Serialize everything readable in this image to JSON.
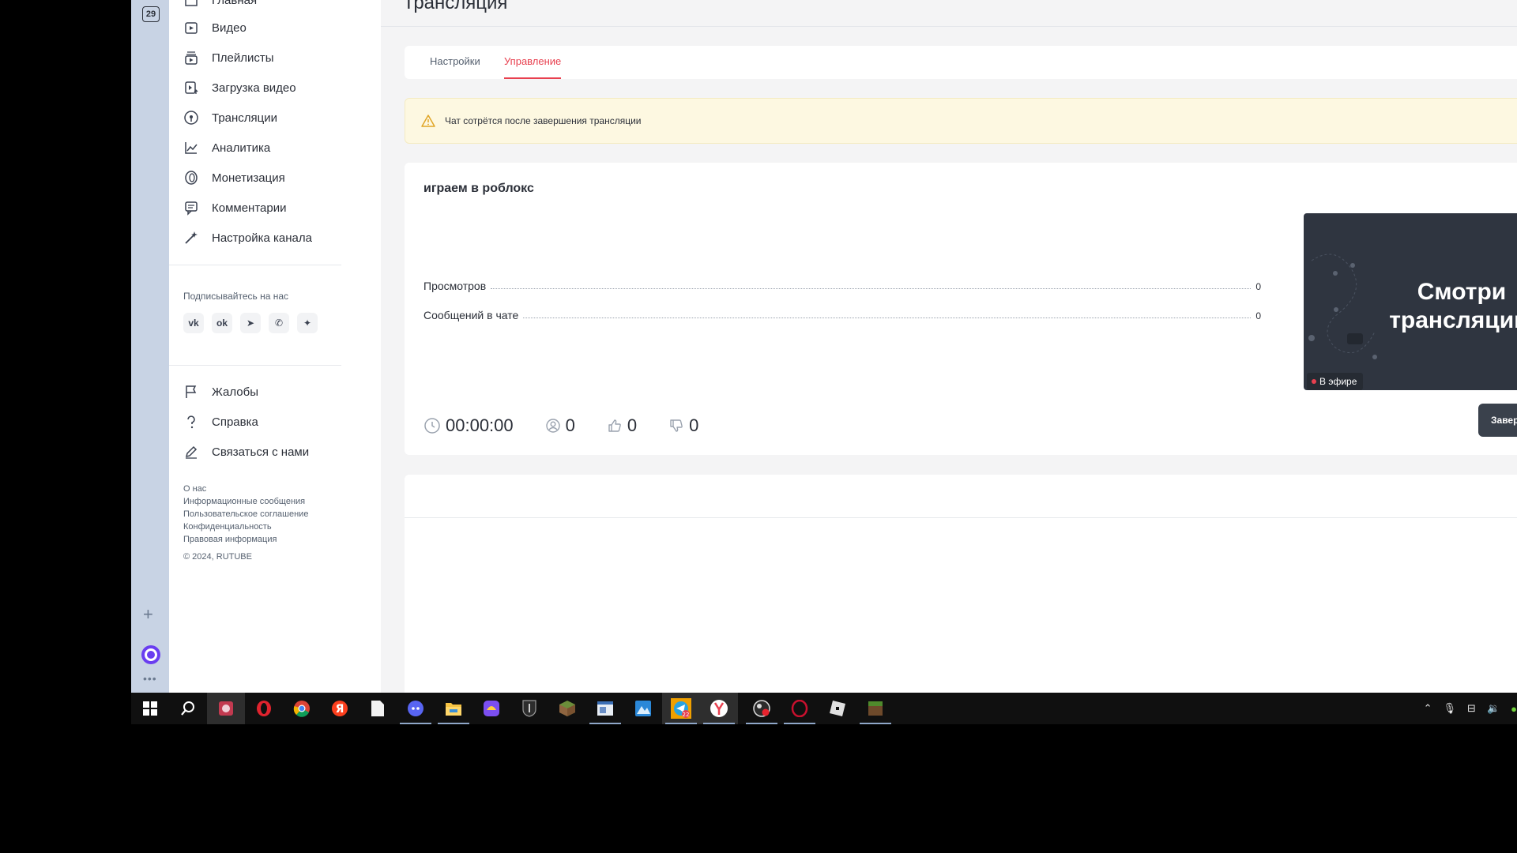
{
  "rail": {
    "badge": "29"
  },
  "sidebar": {
    "items": [
      {
        "label": "Главная",
        "icon": "home-icon"
      },
      {
        "label": "Видео",
        "icon": "video-icon"
      },
      {
        "label": "Плейлисты",
        "icon": "playlist-icon"
      },
      {
        "label": "Загрузка видео",
        "icon": "upload-video-icon"
      },
      {
        "label": "Трансляции",
        "icon": "broadcast-icon"
      },
      {
        "label": "Аналитика",
        "icon": "analytics-icon"
      },
      {
        "label": "Монетизация",
        "icon": "monetization-icon"
      },
      {
        "label": "Комментарии",
        "icon": "comments-icon"
      },
      {
        "label": "Настройка канала",
        "icon": "channel-settings-icon"
      }
    ],
    "follow_title": "Подписывайтесь на нас",
    "socials": [
      {
        "glyph": "vk",
        "icon": "vk-icon"
      },
      {
        "glyph": "ok",
        "icon": "odnoklassniki-icon"
      },
      {
        "glyph": "➤",
        "icon": "telegram-icon"
      },
      {
        "glyph": "✆",
        "icon": "viber-icon"
      },
      {
        "glyph": "✦",
        "icon": "zen-icon"
      }
    ],
    "help_items": [
      {
        "label": "Жалобы",
        "icon": "flag-icon"
      },
      {
        "label": "Справка",
        "icon": "help-icon"
      },
      {
        "label": "Связаться с нами",
        "icon": "contact-icon"
      }
    ],
    "footer_links": [
      "О нас",
      "Информационные сообщения",
      "Пользовательское соглашение",
      "Конфиденциальность",
      "Правовая информация"
    ],
    "copyright": "© 2024, RUTUBE"
  },
  "main": {
    "page_title": "Трансляция",
    "tabs": [
      {
        "label": "Настройки",
        "active": false
      },
      {
        "label": "Управление",
        "active": true
      }
    ],
    "warning": "Чат сотрётся после завершения трансляции",
    "stream": {
      "title": "играем в роблокс",
      "stats": [
        {
          "label": "Просмотров",
          "value": "0"
        },
        {
          "label": "Сообщений в чате",
          "value": "0"
        }
      ],
      "timer": "00:00:00",
      "viewers": "0",
      "likes": "0",
      "dislikes": "0",
      "preview_text": "Смотри трансляцию",
      "live_badge": "В эфире",
      "end_button": "Завершить"
    }
  },
  "taskbar": {
    "apps": [
      "start-icon",
      "search-icon",
      "pinned-app-icon",
      "opera-icon",
      "chrome-icon",
      "yandex-icon",
      "notepad-icon",
      "discord-icon",
      "file-explorer-icon",
      "game-app-icon",
      "world-of-tanks-icon",
      "minecraft-icon",
      "window-app-icon",
      "photos-icon",
      "telegram-icon",
      "yandex-browser-icon",
      "obs-icon",
      "opera-gx-icon",
      "roblox-icon",
      "minecraft-launcher-icon"
    ],
    "telegram_badge": "22",
    "accent": "#e8404f"
  }
}
